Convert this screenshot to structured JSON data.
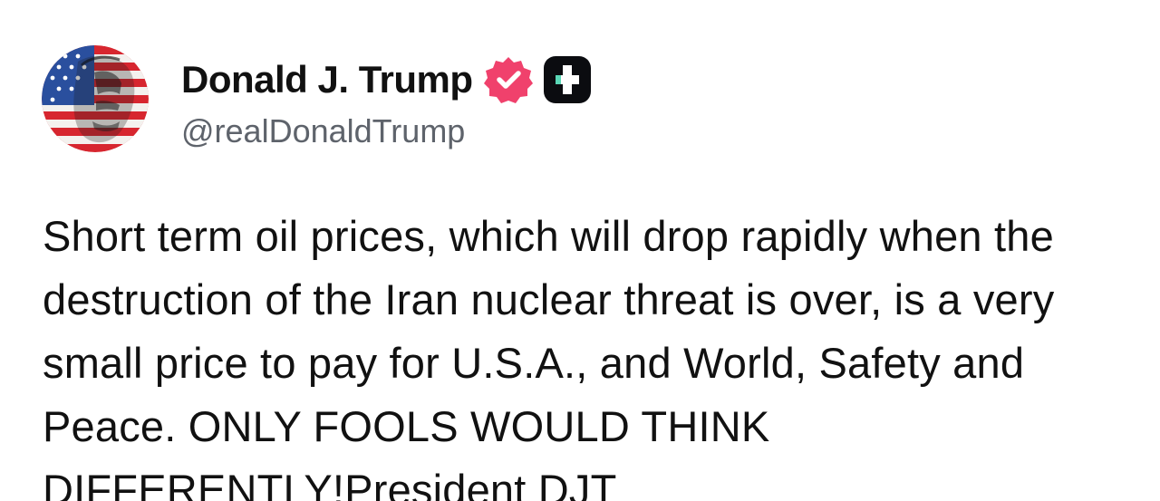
{
  "post": {
    "author": {
      "display_name": "Donald J. Trump",
      "handle": "@realDonaldTrump",
      "avatar_icon": "american-flag-portrait-avatar",
      "verified_icon": "verified-badge-icon",
      "platform_icon": "truth-social-logo-icon"
    },
    "body": "Short term oil prices, which will drop rapidly when the destruction of the Iran nuclear threat is over, is a very small price to pay for U.S.A., and World, Safety and Peace. ONLY FOOLS WOULD THINK DIFFERENTLY!President DJT"
  },
  "colors": {
    "background": "#ffffff",
    "text": "#111111",
    "handle": "#5e636b",
    "verified": "#f0416c",
    "logo_bg": "#0b0c10",
    "logo_accent": "#5ad7b6"
  }
}
